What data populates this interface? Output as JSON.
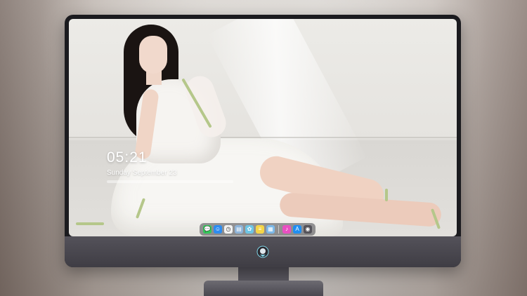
{
  "lock_screen": {
    "time": "05:21",
    "date": "Sunday September 23"
  },
  "dock": {
    "apps": [
      {
        "name": "messages-icon",
        "color": "#34c759",
        "glyph": "💬"
      },
      {
        "name": "finder-icon",
        "color": "#2d8cf0",
        "glyph": "☺"
      },
      {
        "name": "clock-icon",
        "color": "#f2f2f2",
        "glyph": "◷"
      },
      {
        "name": "preview-icon",
        "color": "#8fb4d9",
        "glyph": "▤"
      },
      {
        "name": "photos-icon",
        "color": "#6ec6e6",
        "glyph": "✿"
      },
      {
        "name": "notes-icon",
        "color": "#f5d547",
        "glyph": "≡"
      },
      {
        "name": "gallery-icon",
        "color": "#7cb8e8",
        "glyph": "▦"
      },
      {
        "name": "music-icon",
        "color": "#e84fc1",
        "glyph": "♪"
      },
      {
        "name": "app-store-icon",
        "color": "#1f8ef1",
        "glyph": "A"
      },
      {
        "name": "camera-icon",
        "color": "#55535a",
        "glyph": "◉"
      }
    ]
  },
  "colors": {
    "monitor_bezel": "#1b1b1f",
    "chin": "#4a4850",
    "logo_accent": "#7fd3e6"
  }
}
